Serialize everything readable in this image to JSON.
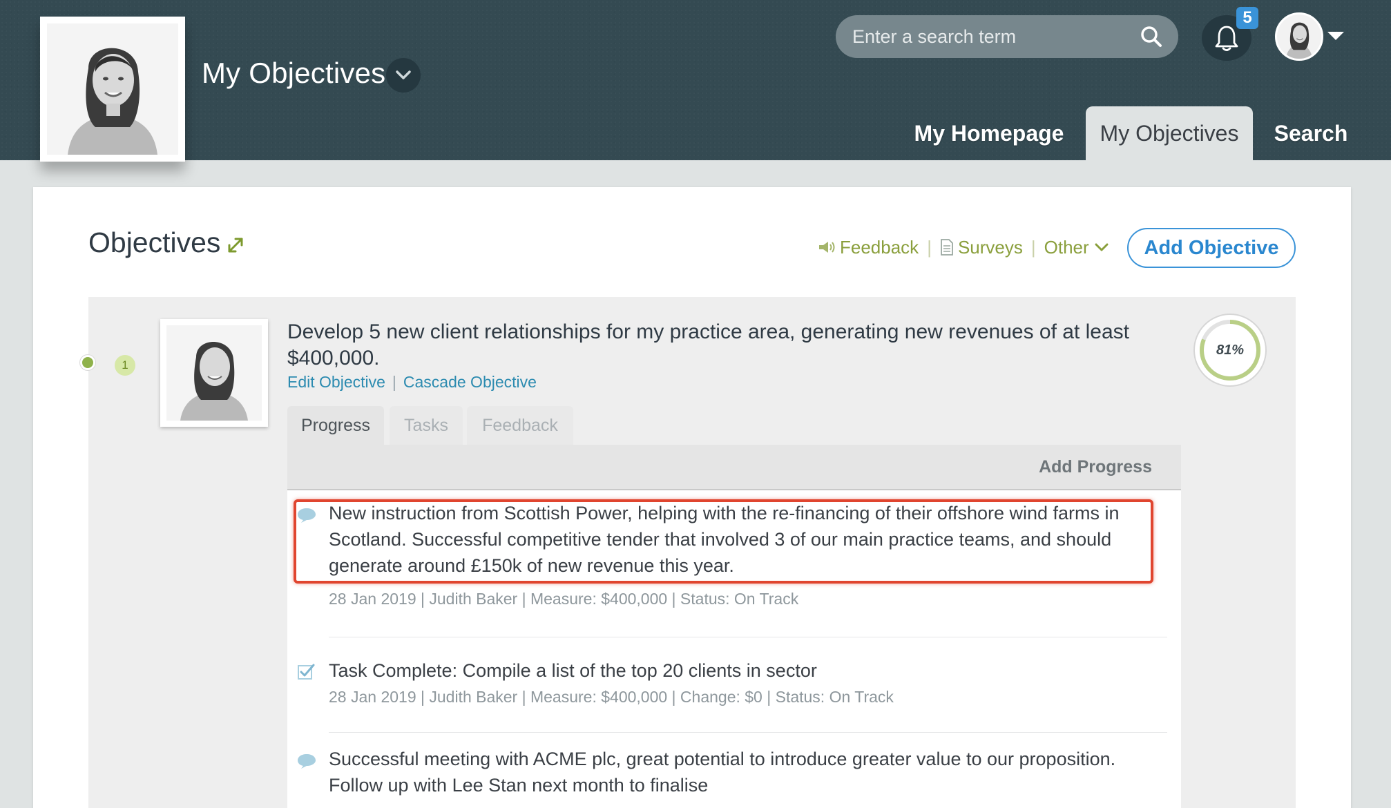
{
  "header": {
    "page_title": "My Objectives",
    "search": {
      "placeholder": "Enter a search term"
    },
    "notifications_count": "5",
    "nav_tabs": [
      {
        "label": "My Homepage",
        "active": false
      },
      {
        "label": "My Objectives",
        "active": true
      },
      {
        "label": "Search",
        "active": false
      }
    ]
  },
  "section": {
    "heading": "Objectives",
    "toolbar": {
      "feedback_label": "Feedback",
      "surveys_label": "Surveys",
      "other_label": "Other",
      "separator": "|"
    },
    "add_objective_label": "Add Objective"
  },
  "objective": {
    "rank": "1",
    "title": "Develop 5 new client relationships for my practice area, generating new revenues of at least $400,000.",
    "edit_label": "Edit Objective",
    "cascade_label": "Cascade Objective",
    "link_separator": "|",
    "progress_percent_label": "81%",
    "progress_fraction": 0.81,
    "tabs": [
      {
        "label": "Progress",
        "active": true
      },
      {
        "label": "Tasks",
        "active": false
      },
      {
        "label": "Feedback",
        "active": false
      }
    ],
    "add_progress_label": "Add Progress",
    "entries": [
      {
        "icon": "comment-icon",
        "text": "New instruction from Scottish Power, helping with the re-financing of their offshore wind farms in Scotland. Successful competitive tender that involved 3 of our main practice teams, and should generate around £150k of new revenue this year.",
        "meta": "28 Jan 2019 | Judith Baker | Measure: $400,000 | Status: On Track",
        "highlighted": true
      },
      {
        "icon": "checkbox-icon",
        "text": "Task Complete: Compile a list of the top 20 clients in sector",
        "meta": "28 Jan 2019 | Judith Baker | Measure: $400,000 | Change: $0 | Status: On Track",
        "highlighted": false
      },
      {
        "icon": "comment-icon",
        "text": "Successful meeting with ACME plc, great potential to introduce greater value to our proposition. Follow up with Lee Stan next month to finalise",
        "meta": "",
        "highlighted": false
      }
    ]
  },
  "colors": {
    "header_bg": "#344a52",
    "accent_green": "#8a9f3c",
    "link_blue": "#2c8bb0",
    "button_blue": "#3a93d8",
    "highlight_red": "#e0452f",
    "progress_green": "#b9cf86"
  }
}
